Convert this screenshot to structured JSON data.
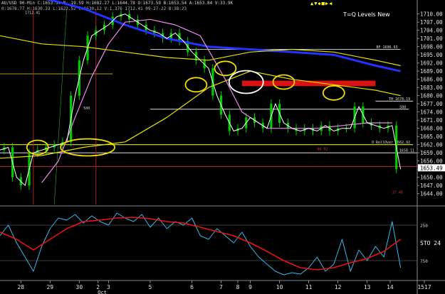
{
  "header": {
    "line1": "AU/USD 90-Min C:1653.54 N: 19.59 H:1682.27 L:1644.78 O:1673.59 B:1653.54 A:1653.84 V:33.9K",
    "line2": "0:1678.77 H:1630.33 L:1622.52 C:1630.12 V:1.376 1712.41 09-27-22 8:38:23",
    "top_marker": "1712.41",
    "icons": "▲▼◆■▶◀"
  },
  "chart_title": "T=Q Levels New",
  "colors": {
    "background": "#000000",
    "price": "#ffffff",
    "candle": "#00cc00",
    "ma_blue": "#2233ff",
    "ma_yellow": "#e8e000",
    "ma_pink": "#ee88ee",
    "stoch_k": "#33bbee",
    "stoch_d": "#ee1111",
    "circle": "#f0e000",
    "highlight_rect": "#dd1111",
    "vline": "#aa2222"
  },
  "chart_data": [
    {
      "type": "line",
      "panel": "price",
      "ylim": [
        1640,
        1712
      ],
      "yticks": [
        1644,
        1647,
        1650,
        1653,
        1656,
        1659,
        1662,
        1665,
        1668,
        1671,
        1674,
        1677,
        1680,
        1683,
        1686,
        1689,
        1692,
        1695,
        1698,
        1701,
        1704,
        1707,
        1710
      ],
      "last_price_label": "1653.49",
      "x_tick_labels": [
        "28",
        "29",
        "30",
        "2",
        "3",
        "5",
        "6",
        "7",
        "8",
        "9",
        "10",
        "11",
        "12",
        "13",
        "14",
        "1517"
      ],
      "x_sub_label": "Oct",
      "series": [
        {
          "kind": "price",
          "x": [
            0,
            2,
            4,
            6,
            8,
            10,
            12,
            14,
            16,
            18,
            20,
            22,
            24,
            26,
            28,
            30,
            32,
            34,
            36,
            38,
            40,
            42,
            44,
            46,
            48,
            50,
            52,
            54,
            56,
            58,
            60,
            62,
            64,
            66,
            68,
            70,
            72,
            74,
            76,
            78,
            80,
            82,
            84,
            86,
            88,
            90,
            92,
            94,
            96
          ],
          "values": [
            1660,
            1661,
            1650,
            1647,
            1659,
            1660,
            1661,
            1662,
            1663,
            1680,
            1693,
            1702,
            1704,
            1706,
            1709,
            1710,
            1708,
            1706,
            1704,
            1703,
            1701,
            1703,
            1700,
            1696,
            1693,
            1690,
            1680,
            1673,
            1667,
            1668,
            1672,
            1670,
            1668,
            1677,
            1670,
            1668,
            1667,
            1668,
            1667,
            1669,
            1667,
            1668,
            1668,
            1676,
            1670,
            1669,
            1668,
            1669,
            1653
          ]
        },
        {
          "kind": "ma_blue",
          "x": [
            0,
            10,
            20,
            30,
            40,
            50,
            60,
            70,
            80,
            90,
            96
          ],
          "values": [
            1719,
            1716,
            1712,
            1706,
            1701,
            1698,
            1697,
            1696,
            1695,
            1691,
            1689
          ]
        },
        {
          "kind": "ma_yellow_upper",
          "x": [
            0,
            10,
            20,
            30,
            40,
            50,
            60,
            70,
            80,
            90,
            96
          ],
          "values": [
            1702,
            1699,
            1698,
            1696,
            1694,
            1693,
            1696,
            1697,
            1696,
            1693,
            1691
          ]
        },
        {
          "kind": "ma_yellow_lower",
          "x": [
            0,
            10,
            20,
            30,
            40,
            50,
            60,
            70,
            80,
            90,
            96
          ],
          "values": [
            1657,
            1658,
            1661,
            1663,
            1672,
            1683,
            1689,
            1686,
            1684,
            1682,
            1680
          ]
        },
        {
          "kind": "ma_pink",
          "x": [
            10,
            14,
            18,
            22,
            26,
            30,
            36,
            42,
            48,
            54,
            58,
            64,
            70,
            76,
            82,
            88,
            94
          ],
          "values": [
            1648,
            1656,
            1672,
            1687,
            1699,
            1707,
            1708,
            1706,
            1702,
            1686,
            1674,
            1668,
            1668,
            1668,
            1669,
            1670,
            1670
          ]
        }
      ],
      "horizontal_levels": [
        {
          "value": 1697,
          "x_start": 36,
          "x_end": 96,
          "label": "BF 1696.93"
        },
        {
          "value": 1678,
          "x_start": 90,
          "x_end": 99,
          "label": "TH 1678.19"
        },
        {
          "value": 1675,
          "x_start": 36,
          "x_end": 98,
          "label": "500"
        },
        {
          "value": 1662,
          "x_start": 0,
          "x_end": 99,
          "label": "O RollOver 1662.92"
        },
        {
          "value": 1659,
          "x_start": 0,
          "x_end": 100,
          "label": "1658.11"
        },
        {
          "value": 1654,
          "x_start": 0,
          "x_end": 100,
          "label": ""
        },
        {
          "value": 1688,
          "x_start": 0,
          "x_end": 27,
          "label": ""
        }
      ],
      "annotations": [
        {
          "text": "1712.41",
          "x": 6,
          "y": 1710
        },
        {
          "text": "500",
          "x": 20,
          "y": 1675
        },
        {
          "text": "06.92",
          "x": 76,
          "y": 1660
        },
        {
          "text": "37.46",
          "x": 94,
          "y": 1644
        }
      ]
    },
    {
      "type": "line",
      "panel": "stochastic",
      "ylim": [
        0,
        100
      ],
      "ytick_labels": [
        "250",
        "750"
      ],
      "indicator_label": "STO 24",
      "series": [
        {
          "kind": "stoch_k",
          "x": [
            0,
            2,
            4,
            6,
            8,
            10,
            12,
            14,
            16,
            18,
            20,
            22,
            24,
            26,
            28,
            30,
            32,
            34,
            36,
            38,
            40,
            42,
            44,
            46,
            48,
            50,
            52,
            54,
            56,
            58,
            60,
            62,
            64,
            66,
            68,
            70,
            72,
            74,
            76,
            78,
            80,
            82,
            84,
            86,
            88,
            90,
            92,
            94,
            96
          ],
          "values": [
            60,
            75,
            50,
            30,
            10,
            45,
            70,
            85,
            82,
            90,
            78,
            88,
            80,
            75,
            92,
            85,
            80,
            90,
            72,
            85,
            70,
            80,
            75,
            85,
            60,
            55,
            70,
            60,
            50,
            65,
            45,
            30,
            20,
            10,
            5,
            8,
            6,
            15,
            30,
            10,
            20,
            55,
            10,
            40,
            25,
            45,
            30,
            80,
            15
          ]
        },
        {
          "kind": "stoch_d",
          "x": [
            0,
            4,
            8,
            12,
            16,
            20,
            24,
            28,
            32,
            36,
            40,
            44,
            48,
            52,
            56,
            60,
            64,
            68,
            72,
            76,
            80,
            84,
            88,
            92,
            96
          ],
          "values": [
            65,
            55,
            40,
            55,
            70,
            80,
            82,
            85,
            86,
            84,
            80,
            78,
            72,
            66,
            60,
            50,
            38,
            25,
            15,
            12,
            15,
            22,
            28,
            38,
            55
          ]
        }
      ]
    }
  ],
  "circles": [
    {
      "cx": 9,
      "cy": 1661
    },
    {
      "cx": 21,
      "cy": 1661
    },
    {
      "cx": 47,
      "cy": 1684
    },
    {
      "cx": 54,
      "cy": 1690
    },
    {
      "cx": 59,
      "cy": 1685
    },
    {
      "cx": 68,
      "cy": 1685
    },
    {
      "cx": 80,
      "cy": 1681
    }
  ]
}
